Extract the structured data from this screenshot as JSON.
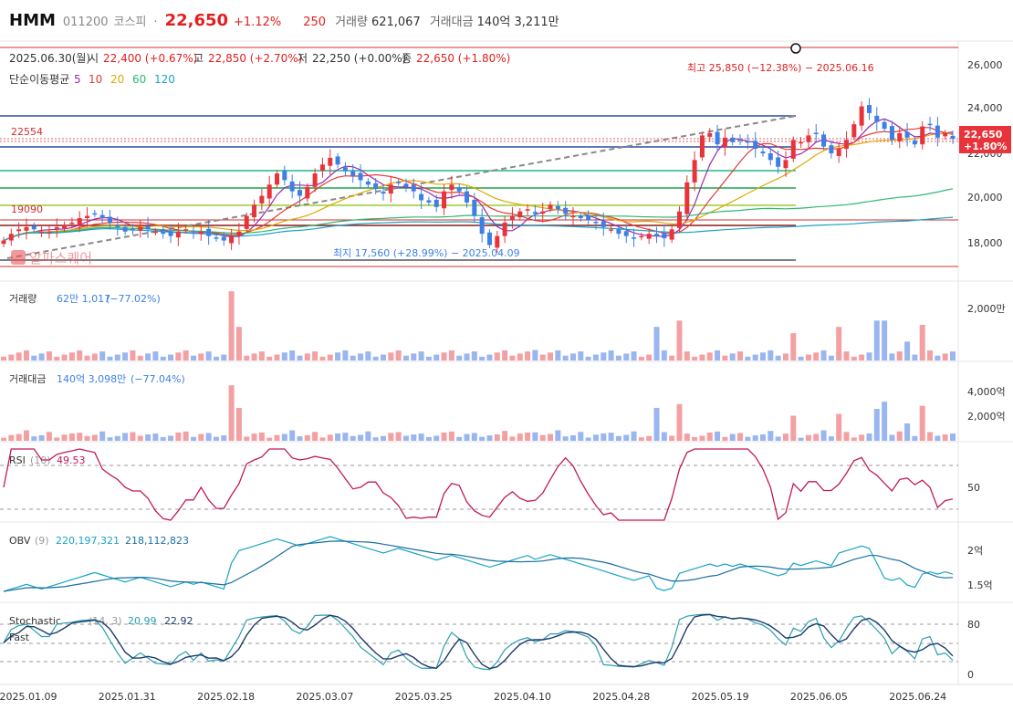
{
  "header": {
    "name": "HMM",
    "code": "011200",
    "market": "코스피",
    "dot": "·",
    "price": "22,650",
    "change_pct": "+1.12%",
    "change": "250",
    "volume_label": "거래량",
    "volume_value": "621,067",
    "amount_label": "거래대금",
    "amount_value": "140억 3,211만"
  },
  "info": {
    "date": "2025.06.30(월)",
    "open_label": "시",
    "open_value": "22,400 (+0.67%)",
    "high_label": "고",
    "high_value": "22,850 (+2.70%)",
    "low_label": "저",
    "low_value": "22,250 (+0.00%)",
    "close_label": "종",
    "close_value": "22,650 (+1.80%)",
    "ma_label": "단순이동평균",
    "ma": [
      {
        "period": "5",
        "color": "#9c27b0"
      },
      {
        "period": "10",
        "color": "#e53935"
      },
      {
        "period": "20",
        "color": "#e0a800"
      },
      {
        "period": "60",
        "color": "#2eb872"
      },
      {
        "period": "120",
        "color": "#18a4c4"
      }
    ]
  },
  "price_panel": {
    "yaxis": [
      "26,000",
      "24,000",
      "22,000",
      "20,000",
      "18,000"
    ],
    "last_price": "22,650",
    "last_pct": "+1.80%",
    "line_label_1": "22554",
    "line_label_2": "19090",
    "high_note": "최고 25,850 (−12.38%) − 2025.06.16",
    "low_note": "최지 17,560 (+28.99%) − 2025.04.09",
    "watermark": "알파스퀘어"
  },
  "volume_panel": {
    "label": "거래량",
    "value": "62만 1,017",
    "pct": "(−77.02%)",
    "axis": "2,000만"
  },
  "amount_panel": {
    "label": "거래대금",
    "value": "140억 3,098만",
    "pct": "(−77.04%)",
    "axis": [
      "4,000억",
      "2,000억"
    ]
  },
  "rsi_panel": {
    "label": "RSI",
    "param": "(10)",
    "value": "49.53",
    "axis": "50"
  },
  "obv_panel": {
    "label": "OBV",
    "param": "(9)",
    "value1": "220,197,321",
    "value2": "218,112,823",
    "axis": [
      "2억",
      "1.5억"
    ]
  },
  "stoch_panel": {
    "label": "Stochastic",
    "param": "(14, 3)",
    "value1": "20.99",
    "value2": "22.92",
    "sub": "Fast",
    "axis": [
      "80",
      "0"
    ]
  },
  "xaxis": [
    "2025.01.09",
    "2025.01.31",
    "2025.02.18",
    "2025.03.07",
    "2025.03.25",
    "2025.04.10",
    "2025.04.28",
    "2025.05.19",
    "2025.06.05",
    "2025.06.24"
  ],
  "colors": {
    "up": "#e8333b",
    "down": "#3d7fe6",
    "up_vol": "#f4a0a3",
    "down_vol": "#9ab6f0",
    "rsi": "#c2185b",
    "obv": "#18a4c4",
    "obv_sig": "#1a6fa0",
    "stoch_fast": "#2aa0b0",
    "stoch_slow": "#1d3b6b"
  },
  "chart_data": {
    "type": "candlestick",
    "close": [
      18100,
      18400,
      18600,
      18700,
      18600,
      18500,
      18500,
      18700,
      18800,
      18900,
      19100,
      19200,
      19300,
      19100,
      18900,
      18700,
      18500,
      18600,
      18700,
      18600,
      18500,
      18400,
      18300,
      18500,
      18600,
      18400,
      18500,
      18300,
      18200,
      18100,
      18300,
      18500,
      19200,
      19700,
      20100,
      20600,
      21100,
      20800,
      20300,
      20100,
      20500,
      21100,
      21500,
      21800,
      21500,
      21200,
      21000,
      20800,
      20600,
      20400,
      20200,
      20600,
      20700,
      20500,
      20300,
      19900,
      19800,
      19600,
      20300,
      20600,
      20300,
      19800,
      19200,
      18400,
      17900,
      18300,
      18900,
      19200,
      19400,
      19500,
      19300,
      19400,
      19700,
      19500,
      19300,
      19200,
      19100,
      19000,
      18900,
      18700,
      18600,
      18400,
      18300,
      18200,
      18300,
      18400,
      18300,
      18200,
      18600,
      19400,
      20700,
      21700,
      22800,
      22900,
      22400,
      22700,
      22500,
      22600,
      22500,
      22200,
      22000,
      21700,
      21400,
      21700,
      22600,
      22500,
      22800,
      22900,
      22300,
      22000,
      22200,
      22600,
      23300,
      24100,
      23800,
      23400,
      23100,
      22600,
      22900,
      22700,
      22400,
      23200,
      23300,
      22700,
      22900,
      22650
    ],
    "volume_axis_max_man": 2000,
    "rsi_last": 49.53,
    "obv_last": 220197321,
    "stoch_last": [
      20.99,
      22.92
    ]
  }
}
